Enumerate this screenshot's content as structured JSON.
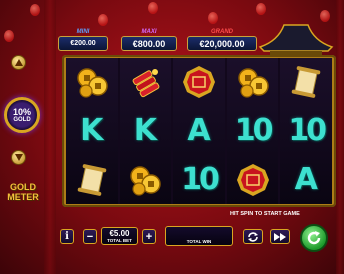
{
  "jackpots": [
    {
      "label": "MINI",
      "value": "€200.00",
      "label_color": "#5ea0ff"
    },
    {
      "label": "MAXI",
      "value": "€800.00",
      "label_color": "#d46bff"
    },
    {
      "label": "GRAND",
      "value": "€20,000.00",
      "label_color": "#ff4d4d"
    }
  ],
  "meter": {
    "percent": "10%",
    "word": "GOLD",
    "title_line1": "GOLD",
    "title_line2": "METER"
  },
  "reels": [
    [
      "coins",
      "K",
      "scroll"
    ],
    [
      "firecrackers",
      "K",
      "coins"
    ],
    [
      "red-badge",
      "A",
      "10"
    ],
    [
      "coins",
      "10",
      "red-badge"
    ],
    [
      "scroll",
      "10",
      "A"
    ]
  ],
  "controls": {
    "info_label": "i",
    "minus_label": "−",
    "plus_label": "+",
    "bet_value": "€5.00",
    "bet_label": "TOTAL BET",
    "win_label": "TOTAL WIN",
    "spin_hint": "HIT SPIN TO START GAME"
  },
  "colors": {
    "accent_gold": "#d9a621",
    "frame": "#ad7d17",
    "background": "#9d0f16",
    "symbol_teal": "#3de0cf"
  }
}
